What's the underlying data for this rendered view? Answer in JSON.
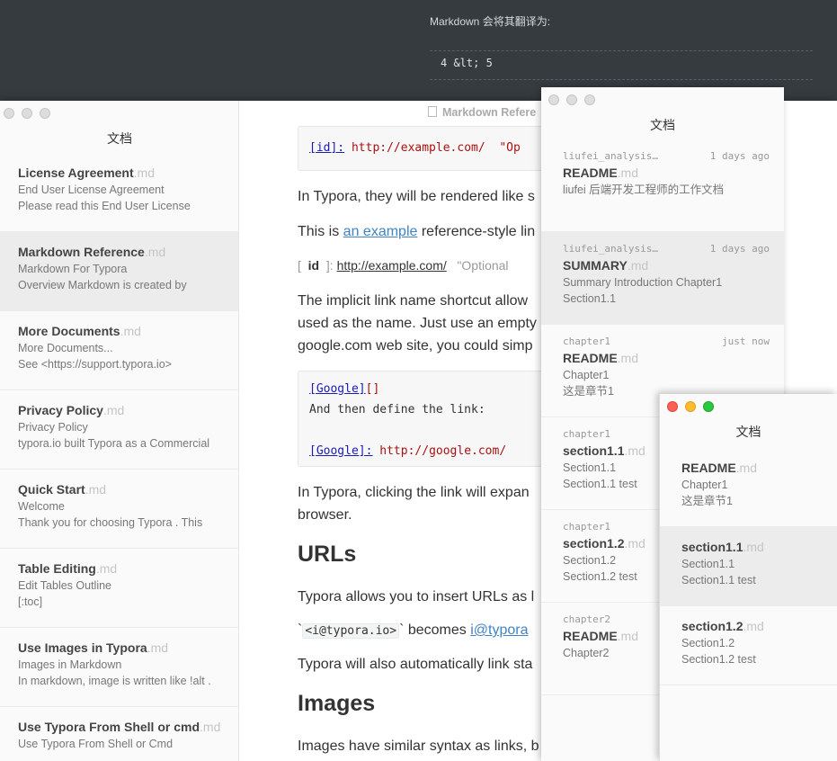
{
  "background_window": {
    "text": "Markdown 会将其翻译为:",
    "code": "4 &lt; 5"
  },
  "main_window": {
    "sidebar_title": "文档",
    "tab_title": "Markdown Refere",
    "files": [
      {
        "name": "License Agreement",
        "ext": ".md",
        "line1": "End User License Agreement",
        "line2": "Please read this End User License"
      },
      {
        "name": "Markdown Reference",
        "ext": ".md",
        "line1": "Markdown For Typora",
        "line2": "Overview Markdown is created by"
      },
      {
        "name": "More Documents",
        "ext": ".md",
        "line1": "More Documents...",
        "line2": "See <https://support.typora.io>"
      },
      {
        "name": "Privacy Policy",
        "ext": ".md",
        "line1": "Privacy Policy",
        "line2": "typora.io built Typora as a Commercial"
      },
      {
        "name": "Quick Start",
        "ext": ".md",
        "line1": "Welcome",
        "line2": "Thank you for choosing Typora . This"
      },
      {
        "name": "Table Editing",
        "ext": ".md",
        "line1": "Edit Tables Outline",
        "line2": "[:toc]"
      },
      {
        "name": "Use Images in Typora",
        "ext": ".md",
        "line1": "Images in Markdown",
        "line2": "In markdown, image is written like !alt ."
      },
      {
        "name": "Use Typora From Shell or cmd",
        "ext": ".md",
        "line1": "Use Typora From Shell or Cmd",
        "line2": ""
      }
    ],
    "content": {
      "code1_ref": "[id]:",
      "code1_url": "http://example.com/",
      "code1_title": "\"Op",
      "p1": "In Typora, they will be rendered like s",
      "p2_before": "This is ",
      "p2_link": "an example",
      "p2_after": " reference-style lin",
      "ref_open": "[",
      "ref_id": "id",
      "ref_close": "]:",
      "ref_url": "http://example.com/",
      "ref_title": "\"Optional",
      "p3_l1": "The implicit link name shortcut allow",
      "p3_l2": "used as the name. Just use an empty",
      "p3_l3": "google.com web site, you could simp",
      "code2_l1_ref": "[Google]",
      "code2_l1_brackets": "[]",
      "code2_l2": "And then define the link:",
      "code2_l4_ref": "[Google]:",
      "code2_l4_url": "http://google.com/",
      "p4_l1": "In Typora, clicking the link will expan",
      "p4_l2": "browser.",
      "h_urls": "URLs",
      "p5": "Typora allows you to insert URLs as l",
      "p6_tick_open": "`",
      "p6_code": "<i@typora.io>",
      "p6_tick_close": "`",
      "p6_mid": " becomes ",
      "p6_link": "i@typora",
      "p7": "Typora will also automatically link sta",
      "h_images": "Images",
      "p8": "Images have similar syntax as links, b"
    }
  },
  "window2": {
    "title": "文档",
    "items": [
      {
        "folder": "liufei_analysis…",
        "time": "1 days ago",
        "name": "README",
        "ext": ".md",
        "line1": "liufei 后端开发工程师的工作文档",
        "line2": ""
      },
      {
        "folder": "liufei_analysis…",
        "time": "1 days ago",
        "name": "SUMMARY",
        "ext": ".md",
        "line1": "Summary Introduction Chapter1",
        "line2": "Section1.1"
      },
      {
        "folder": "chapter1",
        "time": "just now",
        "name": "README",
        "ext": ".md",
        "line1": "Chapter1",
        "line2": "这是章节1"
      },
      {
        "folder": "chapter1",
        "time": "",
        "name": "section1.1",
        "ext": ".md",
        "line1": "Section1.1",
        "line2": "Section1.1 test"
      },
      {
        "folder": "chapter1",
        "time": "",
        "name": "section1.2",
        "ext": ".md",
        "line1": "Section1.2",
        "line2": "Section1.2 test"
      },
      {
        "folder": "chapter2",
        "time": "",
        "name": "README",
        "ext": ".md",
        "line1": "Chapter2",
        "line2": ""
      }
    ]
  },
  "window3": {
    "title": "文档",
    "items": [
      {
        "name": "README",
        "ext": ".md",
        "line1": "Chapter1",
        "line2": "这是章节1"
      },
      {
        "name": "section1.1",
        "ext": ".md",
        "line1": "Section1.1",
        "line2": "Section1.1 test"
      },
      {
        "name": "section1.2",
        "ext": ".md",
        "line1": "Section1.2",
        "line2": "Section1.2 test"
      }
    ]
  }
}
